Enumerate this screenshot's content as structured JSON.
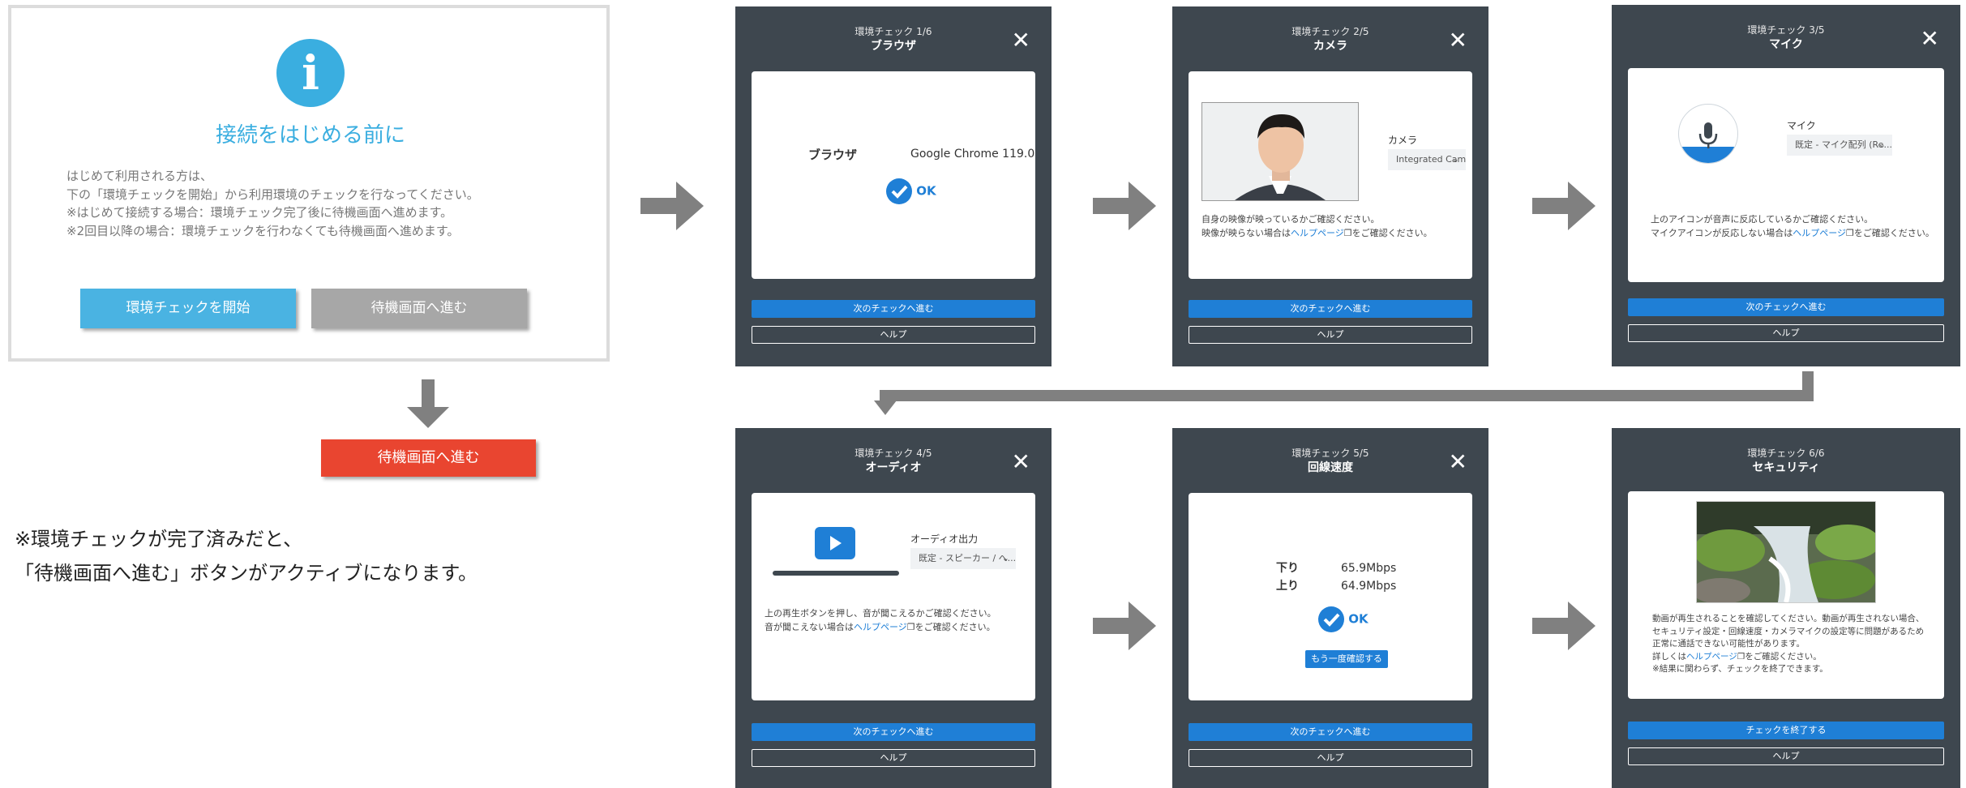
{
  "intro": {
    "title": "接続をはじめる前に",
    "lines": [
      "はじめて利用される方は、",
      "下の「環境チェックを開始」から利用環境のチェックを行なってください。",
      "※はじめて接続する場合：環境チェック完了後に待機画面へ進めます。",
      "※2回目以降の場合：環境チェックを行わなくても待機画面へ進めます。"
    ],
    "start_button": "環境チェックを開始",
    "wait_button": "待機画面へ進む",
    "wait_button_active": "待機画面へ進む",
    "note": [
      "※環境チェックが完了済みだと、",
      "「待機画面へ進む」ボタンがアクティブになります。"
    ]
  },
  "colors": {
    "info_blue": "#3aaee0",
    "panel_bg": "#3e474f",
    "primary_blue": "#1f7fd6",
    "active_red": "#e94530",
    "inactive_gray": "#a7a7a7",
    "arrow_gray": "#808080"
  },
  "panels": {
    "browser": {
      "step": "環境チェック 1/6",
      "name": "ブラウザ",
      "label": "ブラウザ",
      "value": "Google Chrome 119.0",
      "ok": "OK",
      "next": "次のチェックへ進む",
      "help": "ヘルプ"
    },
    "camera": {
      "step": "環境チェック 2/5",
      "name": "カメラ",
      "field_label": "カメラ",
      "select_value": "Integrated Cam...",
      "msg1": "自身の映像が映っているかご確認ください。",
      "msg2_pre": "映像が映らない場合は",
      "msg2_link": "ヘルプページ",
      "msg2_post": "をご確認ください。",
      "next": "次のチェックへ進む",
      "help": "ヘルプ"
    },
    "mic": {
      "step": "環境チェック 3/5",
      "name": "マイク",
      "field_label": "マイク",
      "select_value": "既定 - マイク配列 (Re...",
      "msg1": "上のアイコンが音声に反応しているかご確認ください。",
      "msg2_pre": "マイクアイコンが反応しない場合は",
      "msg2_link": "ヘルプページ",
      "msg2_post": "をご確認ください。",
      "next": "次のチェックへ進む",
      "help": "ヘルプ"
    },
    "audio": {
      "step": "環境チェック 4/5",
      "name": "オーディオ",
      "field_label": "オーディオ出力",
      "select_value": "既定 - スピーカー / へ...",
      "msg1": "上の再生ボタンを押し、音が聞こえるかご確認ください。",
      "msg2_pre": "音が聞こえない場合は",
      "msg2_link": "ヘルプページ",
      "msg2_post": "をご確認ください。",
      "next": "次のチェックへ進む",
      "help": "ヘルプ"
    },
    "network": {
      "step": "環境チェック 5/5",
      "name": "回線速度",
      "down_label": "下り",
      "down_value": "65.9Mbps",
      "up_label": "上り",
      "up_value": "64.9Mbps",
      "ok": "OK",
      "retry": "もう一度確認する",
      "next": "次のチェックへ進む",
      "help": "ヘルプ"
    },
    "security": {
      "step": "環境チェック 6/6",
      "name": "セキュリティ",
      "msg_lines": [
        "動画が再生されることを確認してください。動画が再生されない場合、",
        "セキュリティ設定・回線速度・カメラマイクの設定等に問題があるため",
        "正常に通話できない可能性があります。"
      ],
      "msg_detail_pre": "詳しくは",
      "msg_detail_link": "ヘルプページ",
      "msg_detail_post": "をご確認ください。",
      "msg_last": "※結果に関わらず、チェックを終了できます。",
      "finish": "チェックを終了する",
      "help": "ヘルプ"
    }
  },
  "icons": {
    "info": "info-icon",
    "close": "close-icon",
    "check": "check-circle-icon",
    "mic": "microphone-icon",
    "play": "play-icon",
    "chevron": "chevron-down-icon",
    "external": "external-link-icon"
  }
}
